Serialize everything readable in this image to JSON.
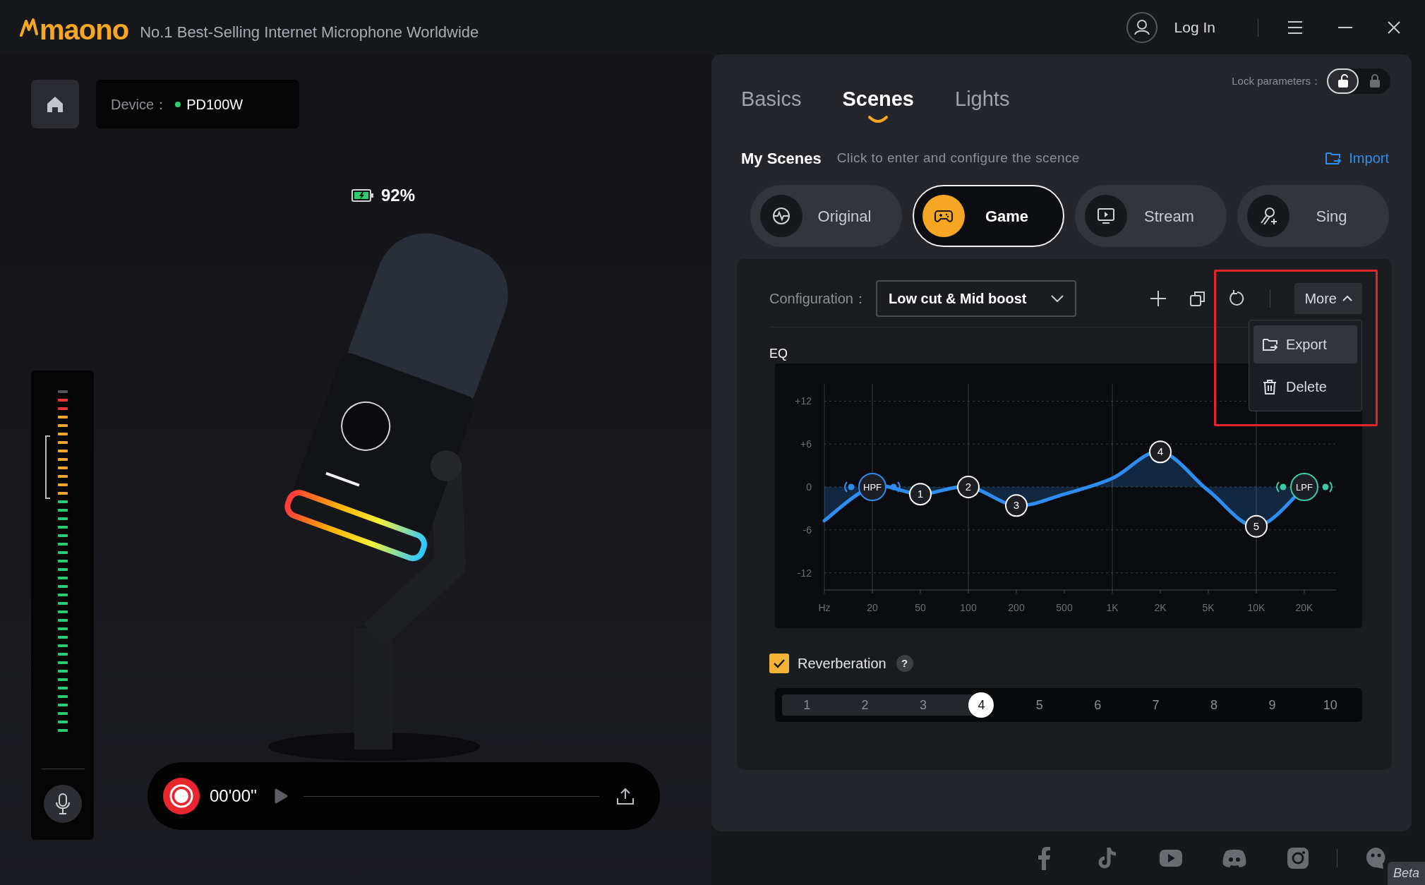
{
  "app": {
    "logo": "maono",
    "tagline": "No.1 Best-Selling Internet Microphone Worldwide",
    "login": "Log In"
  },
  "device": {
    "label": "Device：",
    "name": "PD100W",
    "connected": true
  },
  "battery": {
    "reading": "92%"
  },
  "meter": {
    "level": 0.98
  },
  "recorder": {
    "time": "00'00''"
  },
  "tabs": [
    {
      "label": "Basics",
      "selected": false
    },
    {
      "label": "Scenes",
      "selected": true
    },
    {
      "label": "Lights",
      "selected": false
    }
  ],
  "lock": {
    "label": "Lock parameters：",
    "locked": false
  },
  "scenes": {
    "title": "My Scenes",
    "hint": "Click to enter and configure the scence",
    "import": "Import",
    "items": [
      {
        "label": "Original",
        "selected": false
      },
      {
        "label": "Game",
        "selected": true
      },
      {
        "label": "Stream",
        "selected": false
      },
      {
        "label": "Sing",
        "selected": false
      }
    ]
  },
  "configuration": {
    "label": "Configuration：",
    "value": "Low cut & Mid boost"
  },
  "more": {
    "label": "More",
    "expanded": true,
    "items": [
      {
        "label": "Export",
        "selected": true
      },
      {
        "label": "Delete",
        "selected": false
      }
    ]
  },
  "eq": {
    "chart_data": {
      "type": "line",
      "title": "EQ",
      "grid": true,
      "ylim": [
        -14.4,
        14.4
      ],
      "categories": [
        "Hz",
        "20",
        "50",
        "100",
        "200",
        "500",
        "1K",
        "2K",
        "5K",
        "10K",
        "20K"
      ],
      "yticks": [
        {
          "value": 12,
          "label": "+12"
        },
        {
          "value": 6,
          "label": "+6"
        },
        {
          "value": 0,
          "label": "0"
        },
        {
          "value": -6,
          "label": "-6"
        },
        {
          "value": -12,
          "label": "-12"
        }
      ],
      "series": [
        {
          "color": "#2f8cf0",
          "values": [
            -4.7,
            0,
            -1,
            0,
            -2.6,
            -1,
            1.2,
            4.9,
            -0.5,
            -5.5,
            0
          ]
        }
      ],
      "annotations": [
        {
          "x": "20",
          "y": 0,
          "text": "HPF"
        },
        {
          "x": "50",
          "y": -1,
          "text": "1"
        },
        {
          "x": "100",
          "y": 0,
          "text": "2"
        },
        {
          "x": "200",
          "y": -2.6,
          "text": "3"
        },
        {
          "x": "2K",
          "y": 4.9,
          "text": "4"
        },
        {
          "x": "10K",
          "y": -5.5,
          "text": "5"
        },
        {
          "x": "20K",
          "y": 0,
          "text": "LPF"
        }
      ]
    }
  },
  "reverberation": {
    "label": "Reverberation",
    "checked": true,
    "help": "?",
    "steps": [
      {
        "label": "1",
        "selected": false
      },
      {
        "label": "2",
        "selected": false
      },
      {
        "label": "3",
        "selected": false
      },
      {
        "label": "4",
        "selected": true
      },
      {
        "label": "5",
        "selected": false
      },
      {
        "label": "6",
        "selected": false
      },
      {
        "label": "7",
        "selected": false
      },
      {
        "label": "8",
        "selected": false
      },
      {
        "label": "9",
        "selected": false
      },
      {
        "label": "10",
        "selected": false
      }
    ]
  },
  "footer": {
    "badge": "Beta"
  }
}
